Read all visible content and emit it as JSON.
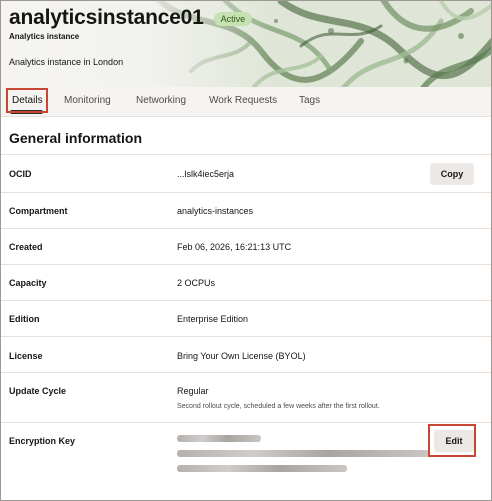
{
  "header": {
    "title": "analyticsinstance01",
    "status": "Active",
    "subtitle": "Analytics instance",
    "description": "Analytics instance in London"
  },
  "tabs": [
    {
      "label": "Details",
      "active": true
    },
    {
      "label": "Monitoring"
    },
    {
      "label": "Networking"
    },
    {
      "label": "Work Requests"
    },
    {
      "label": "Tags"
    }
  ],
  "general": {
    "title": "General information",
    "ocid": {
      "label": "OCID",
      "value": "...lslk4iec5erja",
      "action": "Copy"
    },
    "compartment": {
      "label": "Compartment",
      "value": "analytics-instances"
    },
    "created": {
      "label": "Created",
      "value": "Feb 06, 2026, 16:21:13 UTC"
    },
    "capacity": {
      "label": "Capacity",
      "value": "2 OCPUs"
    },
    "edition": {
      "label": "Edition",
      "value": "Enterprise Edition"
    },
    "license": {
      "label": "License",
      "value": "Bring Your Own License (BYOL)"
    },
    "update_cycle": {
      "label": "Update Cycle",
      "value": "Regular",
      "note": "Second rollout cycle, scheduled a few weeks after the first rollout."
    },
    "encryption_key": {
      "label": "Encryption Key",
      "action": "Edit"
    }
  },
  "colors": {
    "accent_highlight": "#c74634",
    "status_badge_bg": "#c7e0b4",
    "header_pattern": "#6b8a5e"
  }
}
